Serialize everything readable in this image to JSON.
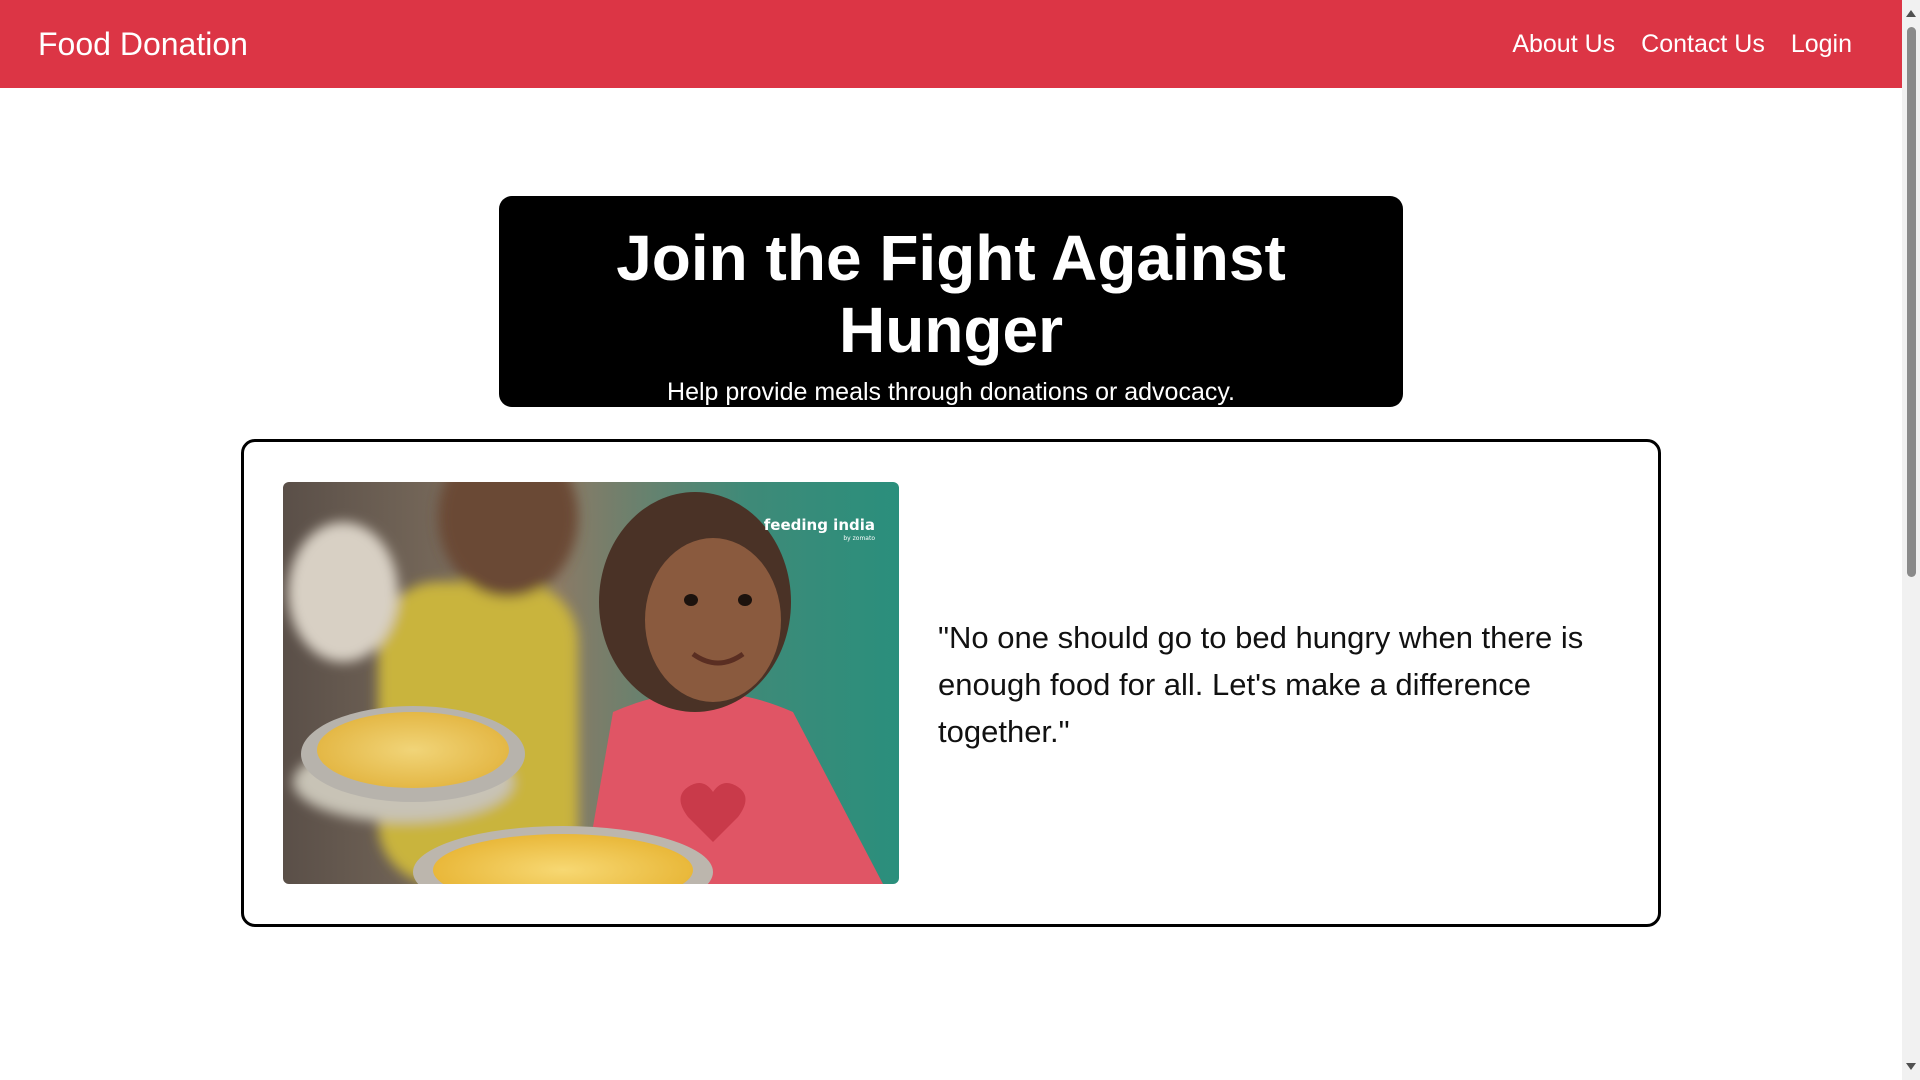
{
  "navbar": {
    "brand": "Food Donation",
    "links": [
      {
        "label": "About Us"
      },
      {
        "label": "Contact Us"
      },
      {
        "label": "Login"
      }
    ],
    "background_color": "#dc3545"
  },
  "hero": {
    "title": "Join the Fight Against Hunger",
    "subtitle": "Help provide meals through donations or advocacy."
  },
  "card": {
    "image": {
      "alt": "Two children holding plates of food",
      "logo_text": "feeding india",
      "logo_sub": "by zomato"
    },
    "quote": "\"No one should go to bed hungry when there is enough food for all. Let's make a difference together.\""
  }
}
